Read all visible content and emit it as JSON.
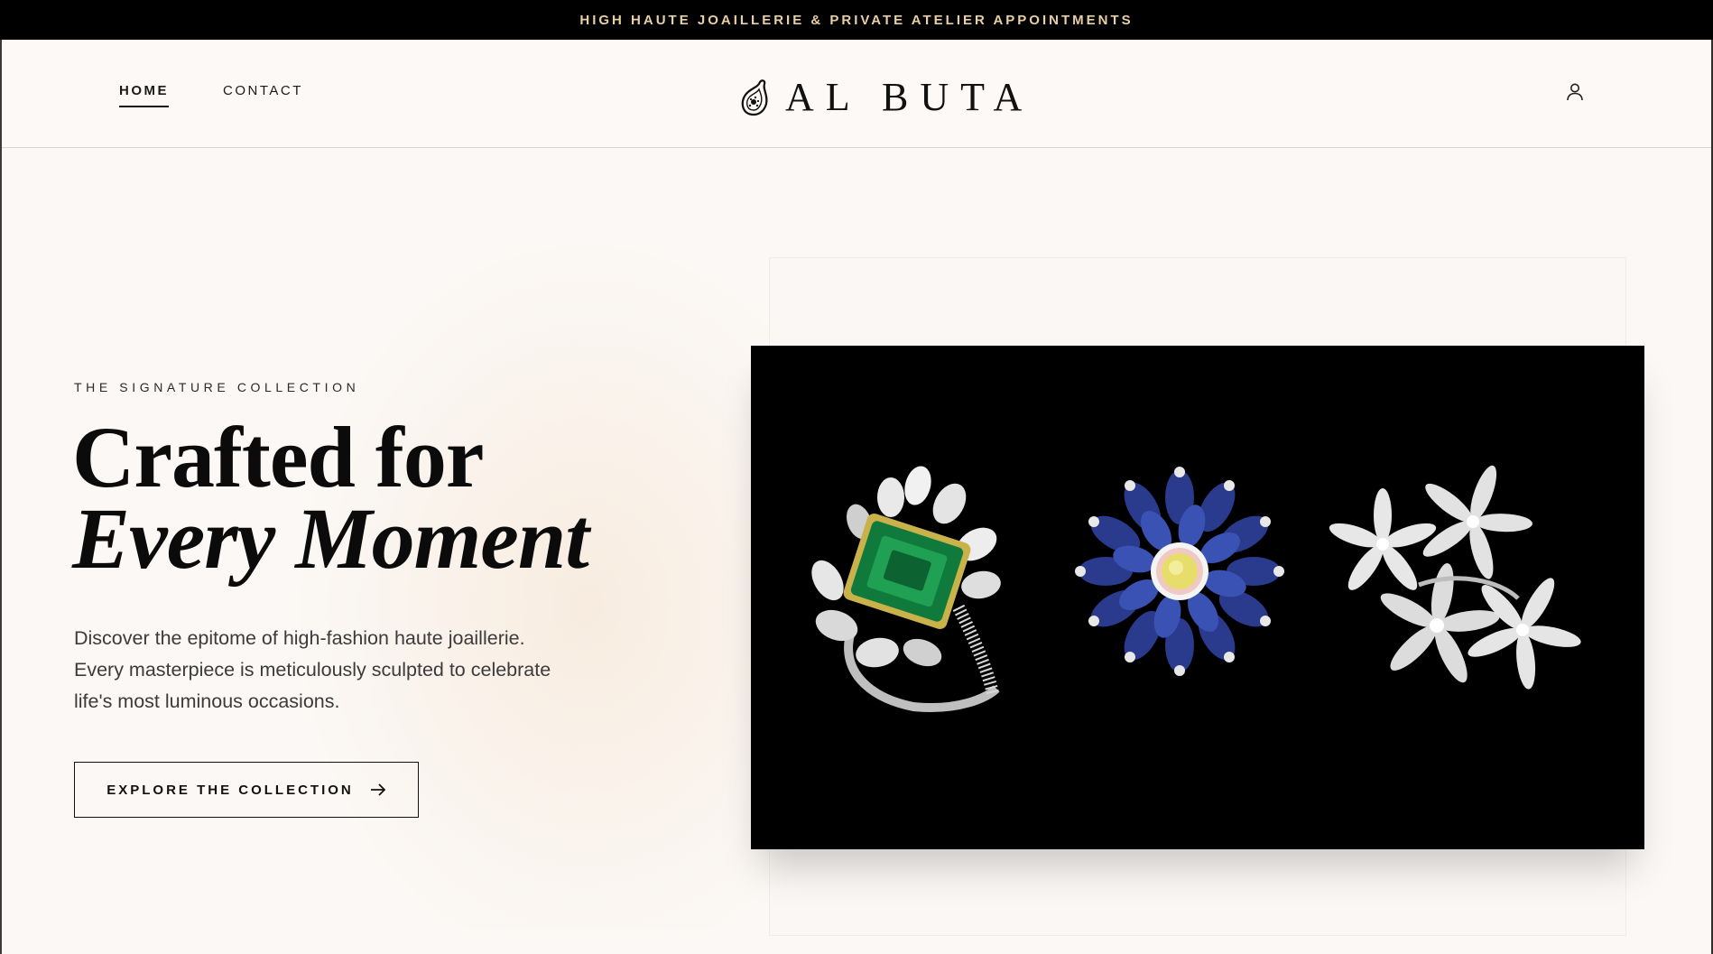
{
  "announcement": {
    "text": "HIGH HAUTE JOAILLERIE & PRIVATE ATELIER APPOINTMENTS"
  },
  "nav": {
    "items": [
      {
        "label": "HOME",
        "active": true
      },
      {
        "label": "CONTACT",
        "active": false
      }
    ]
  },
  "brand": {
    "name": "AL BUTA",
    "mark_icon": "paisley-icon"
  },
  "header": {
    "account_icon": "user-icon"
  },
  "hero": {
    "eyebrow": "THE SIGNATURE COLLECTION",
    "headline_line1": "Crafted for",
    "headline_line2": "Every Moment",
    "body": "Discover the epitome of high-fashion haute joaillerie. Every masterpiece is meticulously sculpted to celebrate life's most luminous occasions.",
    "cta_label": "EXPLORE THE COLLECTION",
    "cta_icon": "arrow-right-icon"
  },
  "colors": {
    "background": "#fbf8f5",
    "topbar": "#000000",
    "topbar_text": "#e8cfa4",
    "ink": "#111111"
  }
}
